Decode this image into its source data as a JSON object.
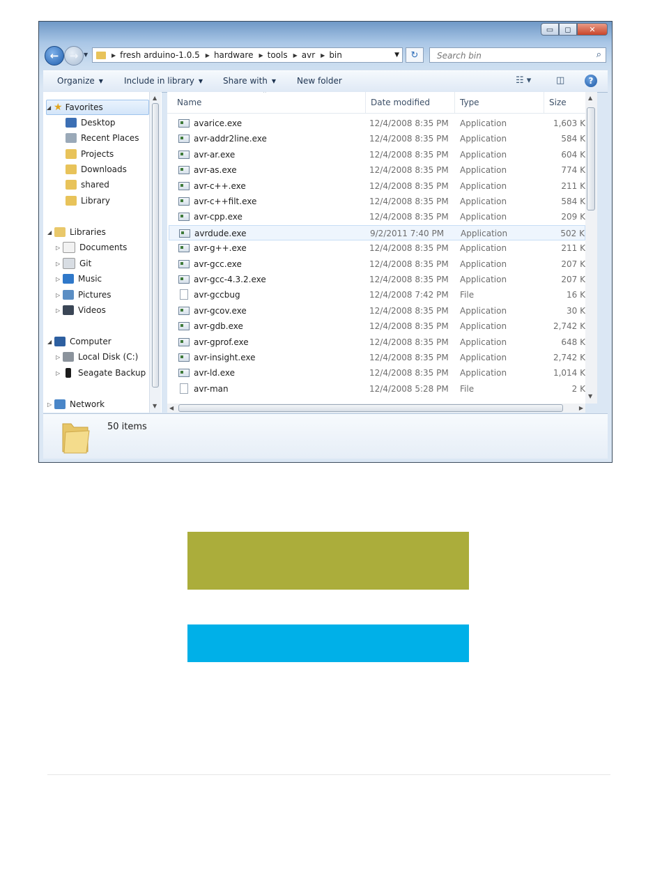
{
  "window": {
    "controls": {
      "minimize": "▭",
      "maximize": "◻",
      "close": "✕"
    }
  },
  "address": {
    "crumbs": [
      "fresh arduino-1.0.5",
      "hardware",
      "tools",
      "avr",
      "bin"
    ],
    "search_placeholder": "Search bin"
  },
  "toolbar": {
    "organize": "Organize",
    "include_in_library": "Include in library",
    "share_with": "Share with",
    "new_folder": "New folder"
  },
  "nav_pane": {
    "favorites": {
      "label": "Favorites",
      "items": [
        "Desktop",
        "Recent Places",
        "Projects",
        "Downloads",
        "shared",
        "Library"
      ]
    },
    "libraries": {
      "label": "Libraries",
      "items": [
        "Documents",
        "Git",
        "Music",
        "Pictures",
        "Videos"
      ]
    },
    "computer": {
      "label": "Computer",
      "items": [
        "Local Disk (C:)",
        "Seagate Backup F"
      ]
    },
    "network": {
      "label": "Network"
    }
  },
  "columns": {
    "name": "Name",
    "date": "Date modified",
    "type": "Type",
    "size": "Size"
  },
  "files": [
    {
      "name": "avarice.exe",
      "date": "12/4/2008 8:35 PM",
      "type": "Application",
      "size": "1,603 K"
    },
    {
      "name": "avr-addr2line.exe",
      "date": "12/4/2008 8:35 PM",
      "type": "Application",
      "size": "584 K"
    },
    {
      "name": "avr-ar.exe",
      "date": "12/4/2008 8:35 PM",
      "type": "Application",
      "size": "604 K"
    },
    {
      "name": "avr-as.exe",
      "date": "12/4/2008 8:35 PM",
      "type": "Application",
      "size": "774 K"
    },
    {
      "name": "avr-c++.exe",
      "date": "12/4/2008 8:35 PM",
      "type": "Application",
      "size": "211 K"
    },
    {
      "name": "avr-c++filt.exe",
      "date": "12/4/2008 8:35 PM",
      "type": "Application",
      "size": "584 K"
    },
    {
      "name": "avr-cpp.exe",
      "date": "12/4/2008 8:35 PM",
      "type": "Application",
      "size": "209 K"
    },
    {
      "name": "avrdude.exe",
      "date": "9/2/2011 7:40 PM",
      "type": "Application",
      "size": "502 K"
    },
    {
      "name": "avr-g++.exe",
      "date": "12/4/2008 8:35 PM",
      "type": "Application",
      "size": "211 K"
    },
    {
      "name": "avr-gcc.exe",
      "date": "12/4/2008 8:35 PM",
      "type": "Application",
      "size": "207 K"
    },
    {
      "name": "avr-gcc-4.3.2.exe",
      "date": "12/4/2008 8:35 PM",
      "type": "Application",
      "size": "207 K"
    },
    {
      "name": "avr-gccbug",
      "date": "12/4/2008 7:42 PM",
      "type": "File",
      "size": "16 K"
    },
    {
      "name": "avr-gcov.exe",
      "date": "12/4/2008 8:35 PM",
      "type": "Application",
      "size": "30 K"
    },
    {
      "name": "avr-gdb.exe",
      "date": "12/4/2008 8:35 PM",
      "type": "Application",
      "size": "2,742 K"
    },
    {
      "name": "avr-gprof.exe",
      "date": "12/4/2008 8:35 PM",
      "type": "Application",
      "size": "648 K"
    },
    {
      "name": "avr-insight.exe",
      "date": "12/4/2008 8:35 PM",
      "type": "Application",
      "size": "2,742 K"
    },
    {
      "name": "avr-ld.exe",
      "date": "12/4/2008 8:35 PM",
      "type": "Application",
      "size": "1,014 K"
    },
    {
      "name": "avr-man",
      "date": "12/4/2008 5:28 PM",
      "type": "File",
      "size": "2 K"
    }
  ],
  "selected_file": "avrdude.exe",
  "status": {
    "item_count": "50 items"
  },
  "colors": {
    "olive_block": "#abad3b",
    "cyan_block": "#00b0e8",
    "window_chrome": "#a9c6e6",
    "selection": "#eef5fd"
  },
  "icons": [
    "back-arrow-icon",
    "forward-arrow-icon",
    "folder-icon",
    "refresh-icon",
    "search-icon",
    "views-icon",
    "preview-pane-icon",
    "help-icon",
    "star-icon",
    "library-icon",
    "computer-icon",
    "network-icon",
    "application-icon",
    "file-icon"
  ]
}
